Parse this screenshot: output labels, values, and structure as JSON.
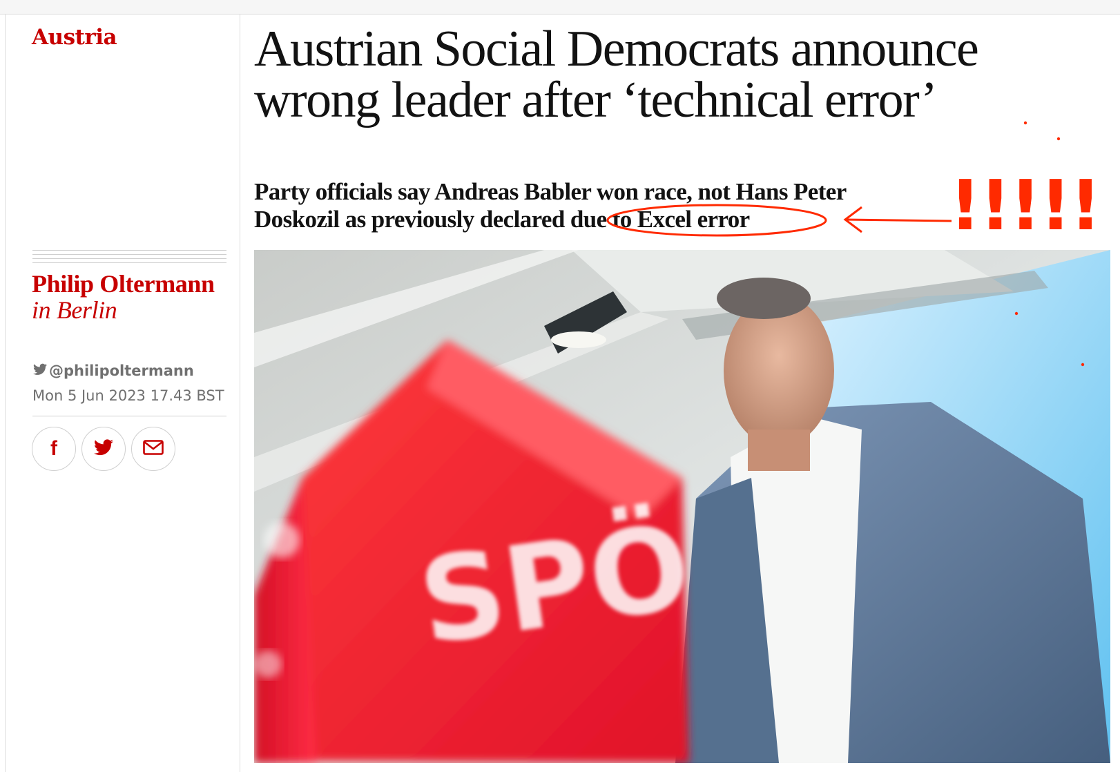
{
  "section": {
    "label": "Austria"
  },
  "article": {
    "headline": "Austrian Social Democrats announce wrong leader after ‘technical error’",
    "standfirst_part1": "Party officials say Andreas Babler won race, not Hans Peter Doskozil as previously declared",
    "standfirst_highlight": "due to Excel error"
  },
  "byline": {
    "name": "Philip Oltermann",
    "in": "in",
    "location": "Berlin",
    "twitter_handle": "@philipoltermann",
    "date": "Mon 5 Jun 2023 17.43 BST"
  },
  "share": {
    "icons": [
      "facebook-icon",
      "twitter-icon",
      "email-icon"
    ]
  },
  "photo": {
    "sign_text": "SPÖ"
  },
  "annotation": {
    "exclamation": "!!!!!",
    "color": "#ff2a00"
  },
  "colors": {
    "accent": "#c70000",
    "meta_grey": "#707070"
  }
}
